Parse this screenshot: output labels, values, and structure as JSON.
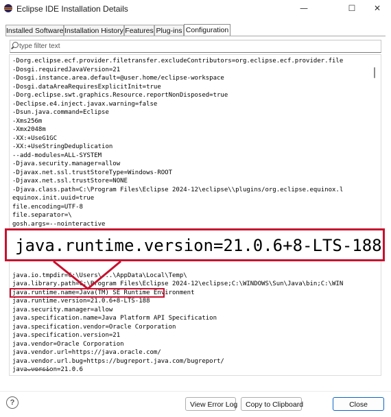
{
  "window": {
    "title": "Eclipse IDE Installation Details",
    "icons": {
      "app": "eclipse-logo-icon",
      "minimize": "minimize-icon",
      "maximize": "maximize-icon",
      "close": "close-icon"
    }
  },
  "tabs": [
    {
      "label": "Installed Software",
      "active": false
    },
    {
      "label": "Installation History",
      "active": false
    },
    {
      "label": "Features",
      "active": false
    },
    {
      "label": "Plug-ins",
      "active": false
    },
    {
      "label": "Configuration",
      "active": true
    }
  ],
  "filter": {
    "placeholder": "type filter text",
    "value": "",
    "icon": "search-icon"
  },
  "configuration_lines": [
    "-Dorg.eclipse.ecf.provider.filetransfer.excludeContributors=org.eclipse.ecf.provider.file",
    "-Dosgi.requiredJavaVersion=21",
    "-Dosgi.instance.area.default=@user.home/eclipse-workspace",
    "-Dosgi.dataAreaRequiresExplicitInit=true",
    "-Dorg.eclipse.swt.graphics.Resource.reportNonDisposed=true",
    "-Declipse.e4.inject.javax.warning=false",
    "-Dsun.java.command=Eclipse",
    "-Xms256m",
    "-Xmx2048m",
    "-XX:+UseG1GC",
    "-XX:+UseStringDeduplication",
    "--add-modules=ALL-SYSTEM",
    "-Djava.security.manager=allow",
    "-Djavax.net.ssl.trustStoreType=Windows-ROOT",
    "-Djavax.net.ssl.trustStore=NONE",
    "-Djava.class.path=C:\\Program Files\\Eclipse 2024-12\\eclipse\\\\plugins/org.eclipse.equinox.l",
    "equinox.init.uuid=true",
    "file.encoding=UTF-8",
    "file.separator=\\",
    "gosh.args=--nointeractive",
    "",
    "",
    "",
    "",
    "",
    "java.io.tmpdir=C:\\Users\\...\\AppData\\Local\\Temp\\",
    "java.library.path=C:\\Program Files\\Eclipse 2024-12\\eclipse;C:\\WINDOWS\\Sun\\Java\\bin;C:\\WIN",
    "java.runtime.name=Java(TM) SE Runtime Environment",
    "java.runtime.version=21.0.6+8-LTS-188",
    "java.security.manager=allow",
    "java.specification.name=Java Platform API Specification",
    "java.specification.vendor=Oracle Corporation",
    "java.specification.version=21",
    "java.vendor=Oracle Corporation",
    "java.vendor.url=https://java.oracle.com/",
    "java.vendor.url.bug=https://bugreport.java.com/bugreport/",
    "java.version=21.0.6"
  ],
  "callout": {
    "text": "java.runtime.version=21.0.6+8-LTS-188",
    "color": "#c8102e"
  },
  "footer": {
    "help_icon": "help-icon",
    "help_glyph": "?",
    "view_error_log": "View Error Log",
    "copy_to_clipboard": "Copy to Clipboard",
    "close": "Close",
    "accent_color": "#0a64c8"
  }
}
